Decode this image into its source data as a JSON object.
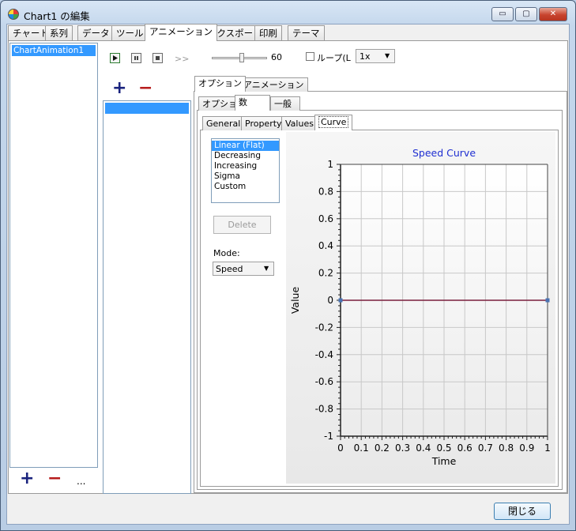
{
  "window": {
    "title": "Chart1 の編集",
    "minimize": "▭",
    "maximize": "▢",
    "close": "✕"
  },
  "main_tabs": [
    "チャート",
    "系列",
    "データ",
    "ツール",
    "アニメーション",
    "エクスポート",
    "印刷",
    "テーマ"
  ],
  "main_tab_active": "アニメーション",
  "animation_list": {
    "items": [
      "ChartAnimation1"
    ],
    "add": "+",
    "remove": "−",
    "more": "..."
  },
  "toolbar": {
    "forward_label": ">>",
    "slider_value": "60",
    "loop_label": "ループ(L",
    "speed_value": "1x",
    "loop_checked": false
  },
  "steps": {
    "add": "+",
    "remove": "−"
  },
  "option_tabs": [
    "オプション",
    "アニメーション"
  ],
  "inner_tabs": [
    "オプション",
    "数",
    "一般"
  ],
  "curve_tabs": [
    "General",
    "Property",
    "Values",
    "Curve"
  ],
  "curve_list": [
    "Linear (Flat)",
    "Decreasing",
    "Increasing",
    "Sigma",
    "Custom"
  ],
  "delete_button": "Delete",
  "mode": {
    "label": "Mode:",
    "value": "Speed"
  },
  "footer": {
    "close_label": "閉じる"
  },
  "chart_data": {
    "type": "line",
    "title": "Speed Curve",
    "xlabel": "Time",
    "ylabel": "Value",
    "xlim": [
      0,
      1
    ],
    "ylim": [
      -1,
      1
    ],
    "x_ticks": [
      "0",
      "0.1",
      "0.2",
      "0.3",
      "0.4",
      "0.5",
      "0.6",
      "0.7",
      "0.8",
      "0.9",
      "1"
    ],
    "y_ticks": [
      "1",
      "0.8",
      "0.6",
      "0.4",
      "0.2",
      "0",
      "-0.2",
      "-0.4",
      "-0.6",
      "-0.8",
      "-1"
    ],
    "grid": true,
    "series": [
      {
        "x": [
          0,
          1
        ],
        "y": [
          0,
          0
        ],
        "color": "#7a1f3d"
      }
    ]
  }
}
